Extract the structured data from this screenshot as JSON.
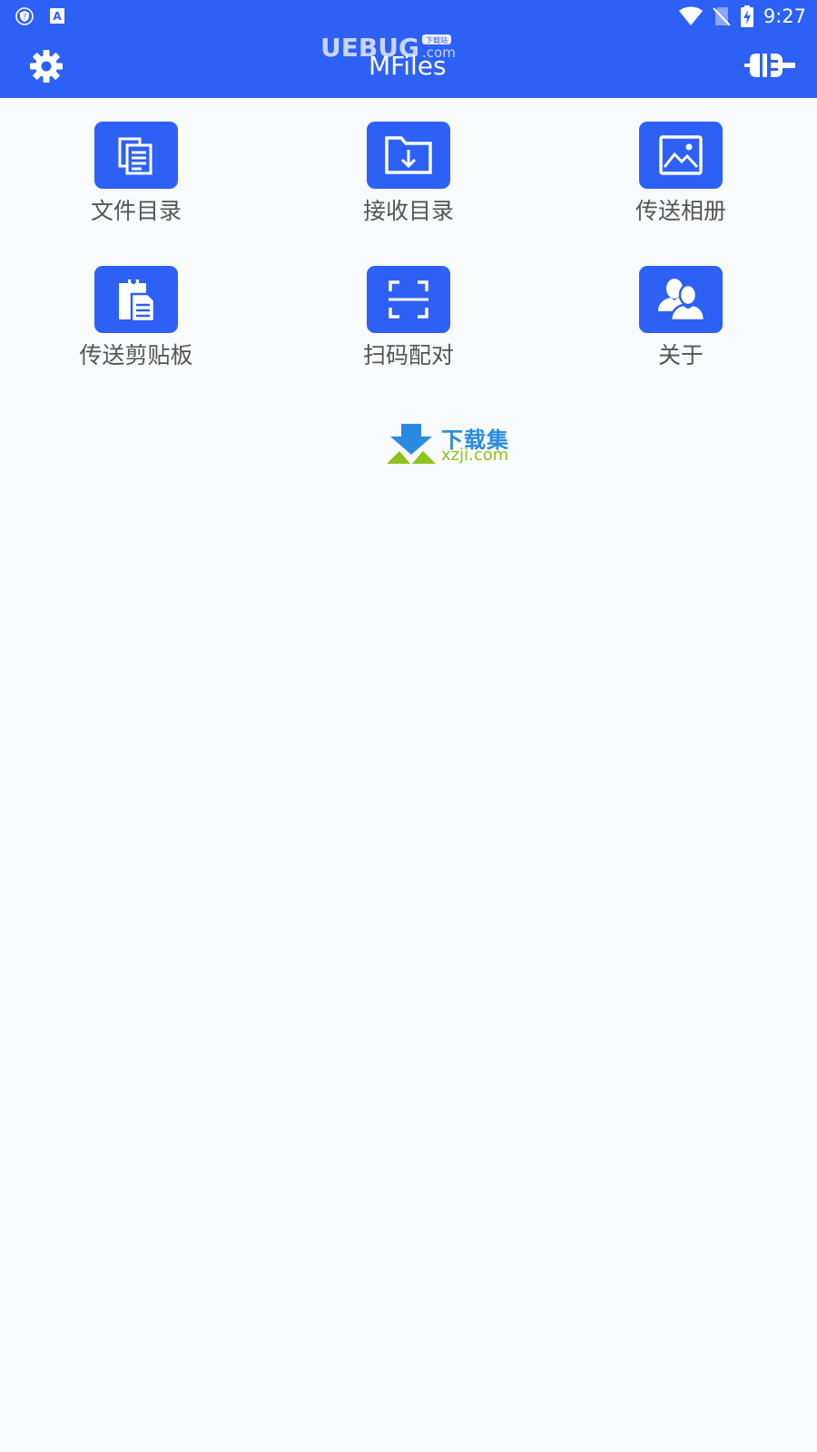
{
  "status_bar": {
    "time": "9:27"
  },
  "toolbar": {
    "title": "MFiles",
    "watermark_brand": "UEBUG",
    "watermark_tag": "下载站",
    "watermark_domain": ".com"
  },
  "grid": {
    "items": [
      {
        "label": "文件目录",
        "icon": "documents-icon"
      },
      {
        "label": "接收目录",
        "icon": "folder-download-icon"
      },
      {
        "label": "传送相册",
        "icon": "image-icon"
      },
      {
        "label": "传送剪贴板",
        "icon": "clipboard-icon"
      },
      {
        "label": "扫码配对",
        "icon": "scan-icon"
      },
      {
        "label": "关于",
        "icon": "users-icon"
      }
    ]
  },
  "bottom_watermark": {
    "title": "下载集",
    "domain": "xzji.com"
  },
  "colors": {
    "primary": "#2d60f5",
    "background": "#f9fafb",
    "label": "#555555"
  }
}
